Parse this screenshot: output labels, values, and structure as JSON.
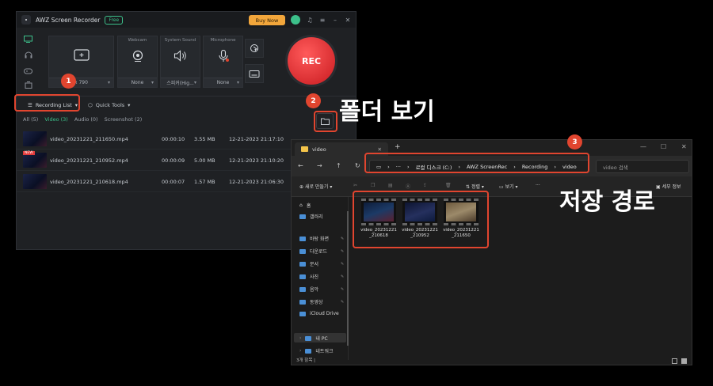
{
  "awz": {
    "title": "AWZ Screen Recorder",
    "free_badge": "Free",
    "buy_now": "Buy Now",
    "sources": {
      "screen_select": "x 790",
      "webcam_label": "Webcam",
      "webcam_select": "None",
      "system_sound_label": "System Sound",
      "system_sound_select": "스피커(Hig...",
      "microphone_label": "Microphone",
      "microphone_select": "None"
    },
    "rec_button": "REC",
    "recording_list": "Recording List",
    "quick_tools": "Quick Tools",
    "filter_tabs": [
      "All (5)",
      "Video (3)",
      "Audio (0)",
      "Screenshot (2)"
    ],
    "new_tag": "NEW",
    "recordings": [
      {
        "name": "video_20231221_211650.mp4",
        "duration": "00:00:10",
        "size": "3.55 MB",
        "date": "12-21-2023 21:17:10"
      },
      {
        "name": "video_20231221_210952.mp4",
        "duration": "00:00:09",
        "size": "5.00 MB",
        "date": "12-21-2023 21:10:20"
      },
      {
        "name": "video_20231221_210618.mp4",
        "duration": "00:00:07",
        "size": "1.57 MB",
        "date": "12-21-2023 21:06:30"
      }
    ]
  },
  "callouts": {
    "badge1": "1",
    "badge2": "2",
    "badge3": "3",
    "folder_view_label": "폴더 보기",
    "save_path_label": "저장 경로"
  },
  "explorer": {
    "tab_title": "video",
    "breadcrumb": [
      "로컬 디스크 (C:)",
      "AWZ ScreenRec",
      "Recording",
      "video"
    ],
    "search_placeholder": "video 검색",
    "cmd": {
      "new": "새로 만들기",
      "sort": "정렬",
      "view": "보기",
      "more": "···",
      "details": "세부 정보"
    },
    "nav_items": [
      "홈",
      "갤러리",
      "바탕 화면",
      "다운로드",
      "문서",
      "사진",
      "음악",
      "동영상",
      "iCloud Drive",
      "내 PC",
      "네트워크"
    ],
    "files": [
      {
        "line1": "video_20231221",
        "line2": "_210618"
      },
      {
        "line1": "video_20231221",
        "line2": "_210952"
      },
      {
        "line1": "video_20231221",
        "line2": "_211650"
      }
    ],
    "status": "3개 항목  |"
  },
  "colors": {
    "accent_green": "#3cc08a",
    "rec_red": "#d8262c",
    "callout_red": "#e1452f",
    "buy_orange": "#f2a63b"
  }
}
